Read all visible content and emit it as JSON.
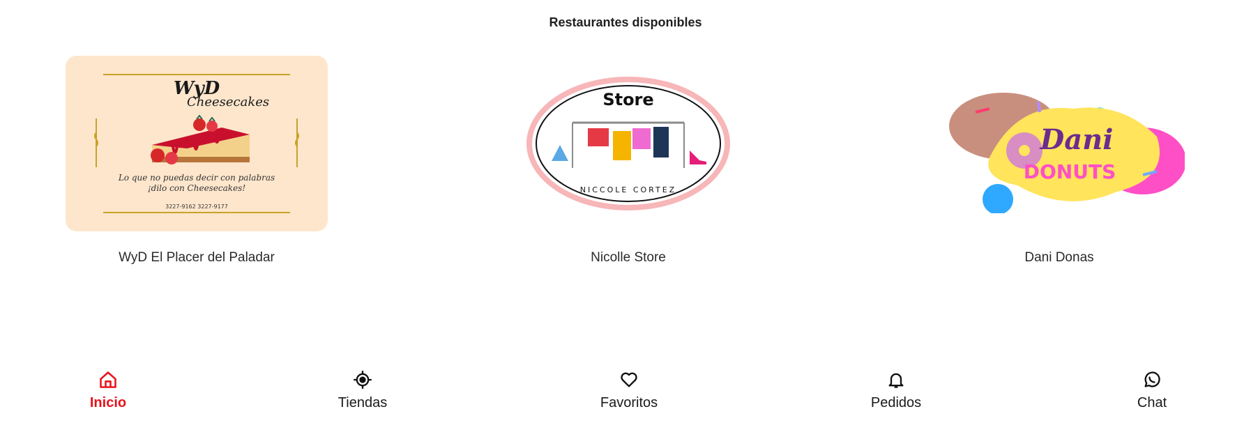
{
  "header": {
    "title": "Restaurantes disponibles"
  },
  "stores": [
    {
      "name": "WyD El Placer del Paladar",
      "logo": {
        "title": "WyD",
        "subtitle": "Cheesecakes",
        "tagline_1": "Lo que no puedas decir con palabras",
        "tagline_2": "¡dilo con Cheesecakes!",
        "phones": "3227-9162 3227-9177",
        "background": "#fde6cc"
      }
    },
    {
      "name": "Nicolle Store",
      "logo": {
        "title": "Store",
        "ring_text": "NICCOLE CORTEZ",
        "ring_color": "#f7b6b8"
      }
    },
    {
      "name": "Dani Donas",
      "logo": {
        "title": "Dani",
        "subtitle": "DONUTS",
        "accent": "#ff4fc7"
      }
    }
  ],
  "nav": {
    "active_color": "#e8131b",
    "items": [
      {
        "label": "Inicio",
        "icon": "home-icon",
        "active": true
      },
      {
        "label": "Tiendas",
        "icon": "location-target-icon",
        "active": false
      },
      {
        "label": "Favoritos",
        "icon": "heart-icon",
        "active": false
      },
      {
        "label": "Pedidos",
        "icon": "bell-icon",
        "active": false
      },
      {
        "label": "Chat",
        "icon": "whatsapp-icon",
        "active": false
      }
    ]
  }
}
